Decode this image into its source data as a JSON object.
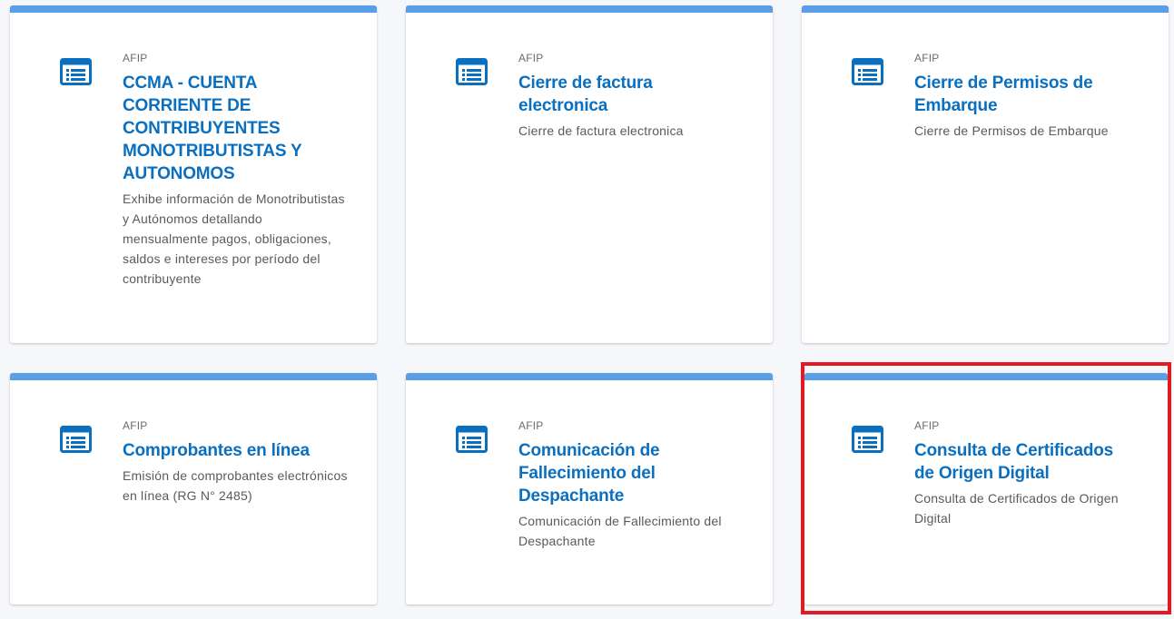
{
  "cards": [
    {
      "org": "AFIP",
      "title": "CCMA - CUENTA CORRIENTE DE CONTRIBUYENTES MONOTRIBUTISTAS Y AUTONOMOS",
      "description": "Exhibe información de Monotributistas y Autónomos detallando mensualmente pagos, obligaciones, saldos e intereses por período del contribuyente",
      "icon": "list-icon"
    },
    {
      "org": "AFIP",
      "title": "Cierre de factura electronica",
      "description": "Cierre de factura electronica",
      "icon": "list-icon"
    },
    {
      "org": "AFIP",
      "title": "Cierre de Permisos de Embarque",
      "description": "Cierre de Permisos de Embarque",
      "icon": "list-icon"
    },
    {
      "org": "AFIP",
      "title": "Comprobantes en línea",
      "description": "Emisión de comprobantes electrónicos en línea (RG N° 2485)",
      "icon": "list-icon"
    },
    {
      "org": "AFIP",
      "title": "Comunicación de Fallecimiento del Despachante",
      "description": "Comunicación de Fallecimiento del Despachante",
      "icon": "list-icon"
    },
    {
      "org": "AFIP",
      "title": "Consulta de Certificados de Origen Digital",
      "description": "Consulta de Certificados de Origen Digital",
      "icon": "list-icon"
    }
  ],
  "colors": {
    "accent_bar": "#5a9ee8",
    "title": "#0b6fbf",
    "icon": "#0b6fbf",
    "highlight": "#e21a23"
  }
}
